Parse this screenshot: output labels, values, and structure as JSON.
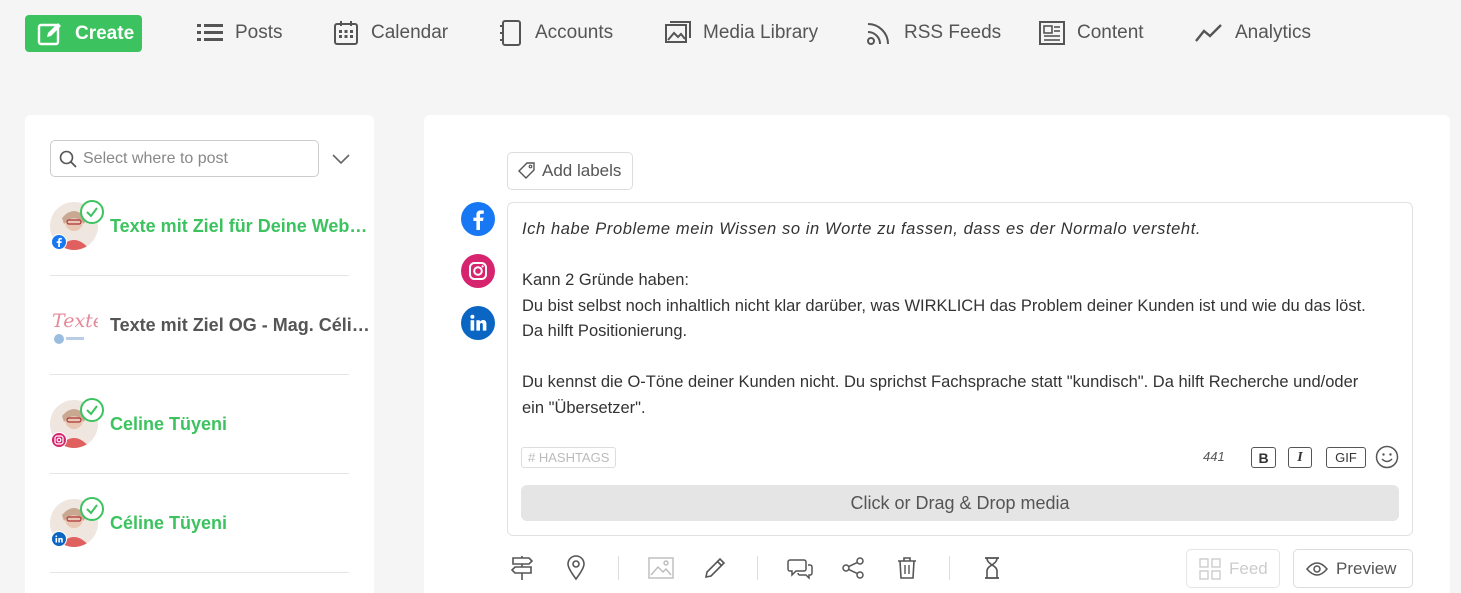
{
  "nav": {
    "create_label": "Create",
    "items": [
      {
        "label": "Posts",
        "icon": "list-icon"
      },
      {
        "label": "Calendar",
        "icon": "calendar-icon"
      },
      {
        "label": "Accounts",
        "icon": "accounts-icon"
      },
      {
        "label": "Media Library",
        "icon": "image-icon"
      },
      {
        "label": "RSS Feeds",
        "icon": "rss-icon"
      },
      {
        "label": "Content",
        "icon": "newspaper-icon"
      },
      {
        "label": "Analytics",
        "icon": "trend-icon"
      }
    ]
  },
  "sidebar": {
    "search_placeholder": "Select where to post",
    "accounts": [
      {
        "name": "Texte mit Ziel für Deine Web…",
        "network": "facebook",
        "selected": true
      },
      {
        "name": "Texte mit Ziel OG - Mag. Céli…",
        "network": "linkedin",
        "selected": false,
        "logo_text": "Texte"
      },
      {
        "name": "Celine Tüyeni",
        "network": "instagram",
        "selected": true
      },
      {
        "name": "Céline Tüyeni",
        "network": "linkedin",
        "selected": true
      }
    ]
  },
  "editor": {
    "add_labels": "Add labels",
    "networks": [
      "facebook",
      "instagram",
      "linkedin"
    ],
    "lines": [
      "Ich habe Probleme mein Wissen so in Worte zu fassen, dass es der Normalo versteht.",
      "",
      "Kann 2 Gründe haben:",
      "Du bist selbst noch inhaltlich nicht klar darüber, was WIRKLICH das Problem deiner Kunden ist und wie du das löst.",
      "Da hilft Positionierung.",
      "",
      "Du kennst die O-Töne deiner Kunden nicht. Du sprichst Fachsprache statt \"kundisch\". Da hilft Recherche und/oder",
      "ein \"Übersetzer\"."
    ],
    "hashtags_label": "# HASHTAGS",
    "char_count": "441",
    "bold_label": "B",
    "italic_label": "I",
    "gif_label": "GIF",
    "media_drop_label": "Click or Drag & Drop media",
    "feed_label": "Feed",
    "preview_label": "Preview"
  },
  "colors": {
    "accent": "#3cc35f",
    "facebook": "#1877f2",
    "instagram": "#d6246e",
    "linkedin": "#0a66c2"
  }
}
